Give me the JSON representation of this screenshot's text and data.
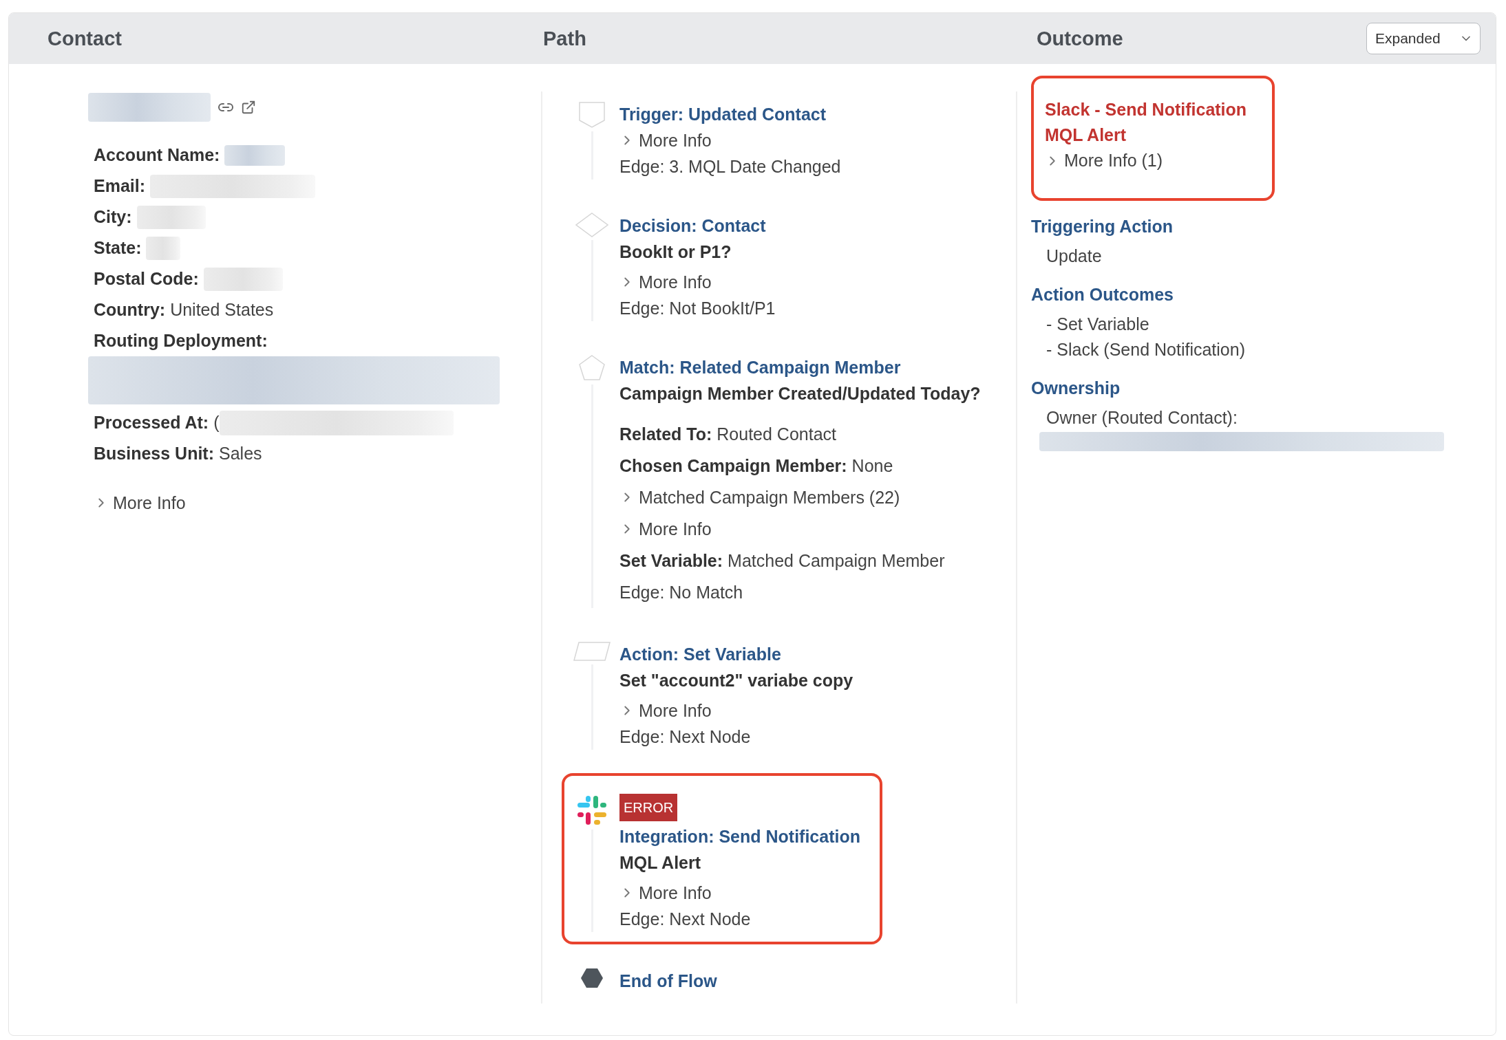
{
  "header": {
    "columns": [
      "Contact",
      "Path",
      "Outcome"
    ],
    "view_select": {
      "value": "Expanded"
    }
  },
  "contact": {
    "name": {
      "kind": "redacted_link"
    },
    "fields": [
      {
        "label": "Account Name:",
        "kind": "redacted_link"
      },
      {
        "label": "Email:",
        "kind": "redacted"
      },
      {
        "label": "City:",
        "kind": "redacted"
      },
      {
        "label": "State:",
        "kind": "redacted"
      },
      {
        "label": "Postal Code:",
        "kind": "redacted"
      },
      {
        "label": "Country:",
        "kind": "text",
        "value": "United States"
      },
      {
        "label": "Routing Deployment:",
        "kind": "redacted_block"
      },
      {
        "label": "Processed At:",
        "kind": "partial",
        "value": "("
      },
      {
        "label": "Business Unit:",
        "kind": "text",
        "value": "Sales"
      }
    ],
    "expander": "More Info"
  },
  "path": [
    {
      "kind": "trigger",
      "title": "Trigger: Updated Contact",
      "highlighted": false,
      "lines": [
        {
          "kind": "expander",
          "text": "More Info"
        },
        {
          "kind": "plain",
          "text": "Edge: 3. MQL Date Changed"
        }
      ]
    },
    {
      "kind": "decision",
      "title": "Decision: Contact",
      "subtitle": "BookIt or P1?",
      "highlighted": false,
      "lines": [
        {
          "kind": "expander",
          "text": "More Info"
        },
        {
          "kind": "plain",
          "text": "Edge: Not BookIt/P1"
        }
      ]
    },
    {
      "kind": "match",
      "title": "Match: Related Campaign Member",
      "subtitle": "Campaign Member Created/Updated Today?",
      "highlighted": false,
      "lines": [
        {
          "kind": "field",
          "label": "Related To:",
          "text": "Routed Contact"
        },
        {
          "kind": "field",
          "label": "Chosen Campaign Member:",
          "text": "None"
        },
        {
          "kind": "expander",
          "text": "Matched Campaign Members (22)"
        },
        {
          "kind": "expander",
          "text": "More Info"
        },
        {
          "kind": "field",
          "label": "Set Variable:",
          "text": "Matched Campaign Member"
        },
        {
          "kind": "plain",
          "text": "Edge: No Match"
        }
      ]
    },
    {
      "kind": "action",
      "title": "Action: Set Variable",
      "subtitle": "Set \"account2\" variabe copy",
      "highlighted": false,
      "lines": [
        {
          "kind": "expander",
          "text": "More Info"
        },
        {
          "kind": "plain",
          "text": "Edge: Next Node"
        }
      ]
    },
    {
      "kind": "integration",
      "badge": "ERROR",
      "title": "Integration: Send Notification",
      "subtitle": "MQL Alert",
      "highlighted": true,
      "lines": [
        {
          "kind": "expander",
          "text": "More Info"
        },
        {
          "kind": "plain",
          "text": "Edge: Next Node"
        }
      ]
    },
    {
      "kind": "end",
      "title": "End of Flow",
      "highlighted": false
    }
  ],
  "outcome": {
    "result": {
      "error": true,
      "title": "Slack - Send Notification",
      "subtitle": "MQL Alert",
      "expander": "More Info (1)",
      "highlighted": true
    },
    "sections": [
      {
        "kind": "list",
        "heading": "Triggering Action",
        "items": [
          "Update"
        ]
      },
      {
        "kind": "list",
        "heading": "Action Outcomes",
        "items": [
          "- Set Variable",
          "- Slack (Send Notification)"
        ]
      },
      {
        "kind": "redacted_value",
        "heading": "Ownership",
        "items": [
          "Owner (Routed Contact):"
        ]
      }
    ]
  }
}
